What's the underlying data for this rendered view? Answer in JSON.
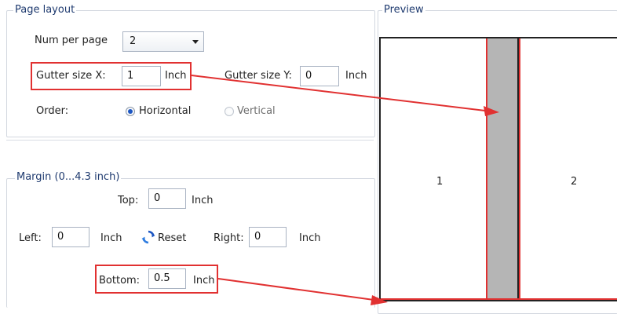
{
  "page_layout": {
    "title": "Page layout",
    "num_per_page": {
      "label": "Num per page",
      "value": "2"
    },
    "gutter_x": {
      "label": "Gutter size X:",
      "value": "1",
      "unit": "Inch"
    },
    "gutter_y": {
      "label": "Gutter size Y:",
      "value": "0",
      "unit": "Inch"
    },
    "order": {
      "label": "Order:",
      "options": [
        {
          "label": "Horizontal",
          "selected": true
        },
        {
          "label": "Vertical",
          "selected": false
        }
      ]
    }
  },
  "margin": {
    "title": "Margin (0...4.3 inch)",
    "top": {
      "label": "Top:",
      "value": "0",
      "unit": "Inch"
    },
    "left": {
      "label": "Left:",
      "value": "0",
      "unit": "Inch"
    },
    "right": {
      "label": "Right:",
      "value": "0",
      "unit": "Inch"
    },
    "bottom": {
      "label": "Bottom:",
      "value": "0.5",
      "unit": "Inch"
    },
    "reset_label": "Reset"
  },
  "preview": {
    "title": "Preview",
    "pages": [
      "1",
      "2"
    ]
  },
  "colors": {
    "highlight": "#e13131",
    "gutter": "#b5b5b5",
    "accent": "#1c56c2"
  }
}
